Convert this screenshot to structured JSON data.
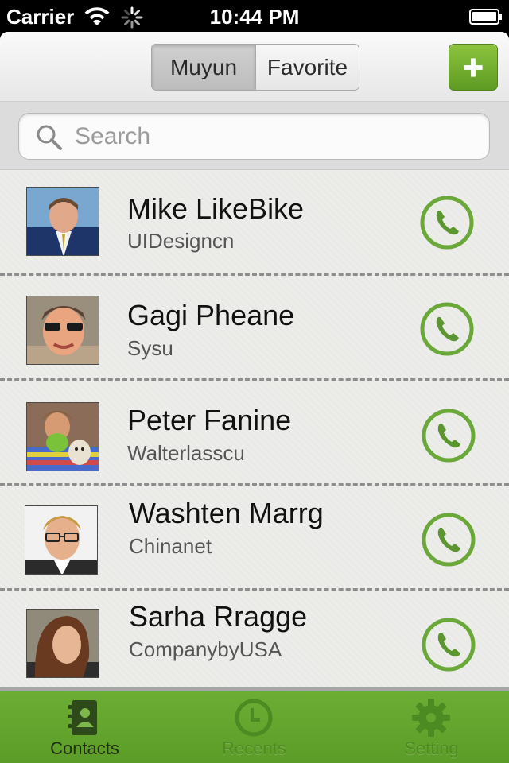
{
  "status_bar": {
    "carrier": "Carrier",
    "time": "10:44 PM",
    "icons": [
      "wifi-icon",
      "activity-spinner-icon",
      "battery-icon"
    ]
  },
  "header": {
    "segments": [
      {
        "label": "Muyun",
        "selected": true
      },
      {
        "label": "Favorite",
        "selected": false
      }
    ],
    "add_button_icon": "plus-icon"
  },
  "search": {
    "placeholder": "Search",
    "value": ""
  },
  "contacts": [
    {
      "name": "Mike LikeBike",
      "company": "UIDesigncn",
      "avatar": "photo-man-suit"
    },
    {
      "name": "Gagi Pheane",
      "company": "Sysu",
      "avatar": "photo-woman-glasses"
    },
    {
      "name": "Peter Fanine",
      "company": "Walterlasscu",
      "avatar": "photo-man-costume-dog"
    },
    {
      "name": "Washten Marrg",
      "company": "Chinanet",
      "avatar": "photo-man-blond-glasses"
    },
    {
      "name": "Sarha Rragge",
      "company": "CompanybyUSA",
      "avatar": "photo-woman-brown-hair"
    }
  ],
  "tabs": [
    {
      "label": "Contacts",
      "icon": "address-book-icon",
      "active": true
    },
    {
      "label": "Recents",
      "icon": "clock-icon",
      "active": false
    },
    {
      "label": "Setting",
      "icon": "gear-icon",
      "active": false
    }
  ],
  "colors": {
    "accent_green": "#5e9b23",
    "tabbar_green": "#62a42d",
    "call_green": "#6aa83a"
  }
}
